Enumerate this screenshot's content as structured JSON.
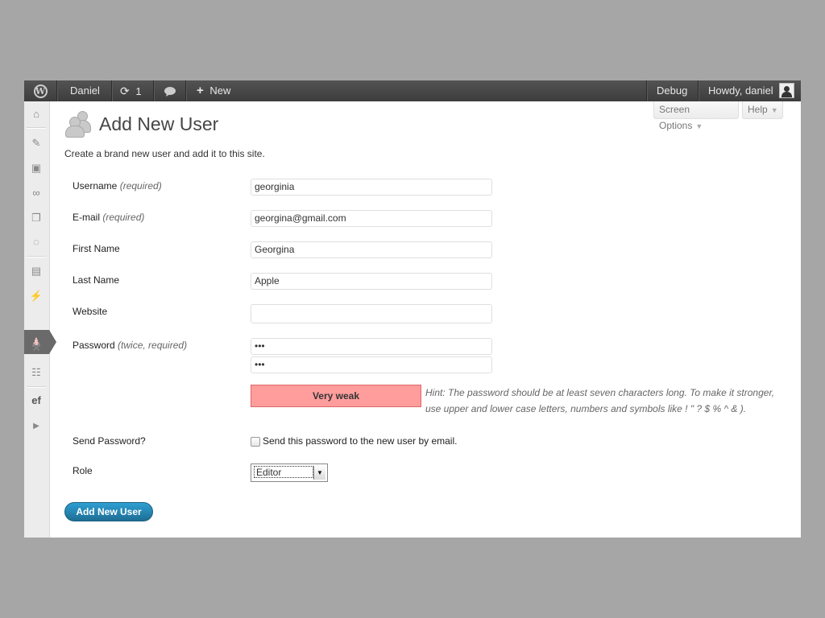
{
  "admin_bar": {
    "site_name": "Daniel",
    "updates_count": "1",
    "new_label": "New",
    "debug_label": "Debug",
    "howdy": "Howdy, daniel"
  },
  "screen_meta": {
    "screen_options": "Screen Options",
    "help": "Help"
  },
  "page": {
    "title": "Add New User",
    "description": "Create a brand new user and add it to this site."
  },
  "form": {
    "username": {
      "label": "Username",
      "note": "(required)",
      "value": "georginia"
    },
    "email": {
      "label": "E-mail",
      "note": "(required)",
      "value": "georgina@gmail.com"
    },
    "first_name": {
      "label": "First Name",
      "value": "Georgina"
    },
    "last_name": {
      "label": "Last Name",
      "value": "Apple"
    },
    "website": {
      "label": "Website",
      "value": ""
    },
    "password": {
      "label": "Password",
      "note": "(twice, required)",
      "value1": "•••",
      "value2": "•••"
    },
    "strength": "Very weak",
    "hint": "Hint: The password should be at least seven characters long. To make it stronger, use upper and lower case letters, numbers and symbols like ! \" ? $ % ^ & ).",
    "send_password": {
      "label": "Send Password?",
      "checkbox_label": "Send this password to the new user by email.",
      "checked": false
    },
    "role": {
      "label": "Role",
      "value": "Editor"
    },
    "submit": "Add New User"
  },
  "colors": {
    "admin_bar": "#464646",
    "strength_bg": "#ff9d9d",
    "primary_button": "#21759b"
  },
  "icons": [
    "wordpress-logo-icon",
    "updates-icon",
    "comment-icon",
    "plus-icon",
    "dashboard-icon",
    "posts-icon",
    "media-icon",
    "links-icon",
    "pages-icon",
    "comments-icon",
    "appearance-icon",
    "plugins-icon",
    "users-icon",
    "tools-icon",
    "settings-icon",
    "plugin-ef-icon",
    "collapse-icon"
  ]
}
